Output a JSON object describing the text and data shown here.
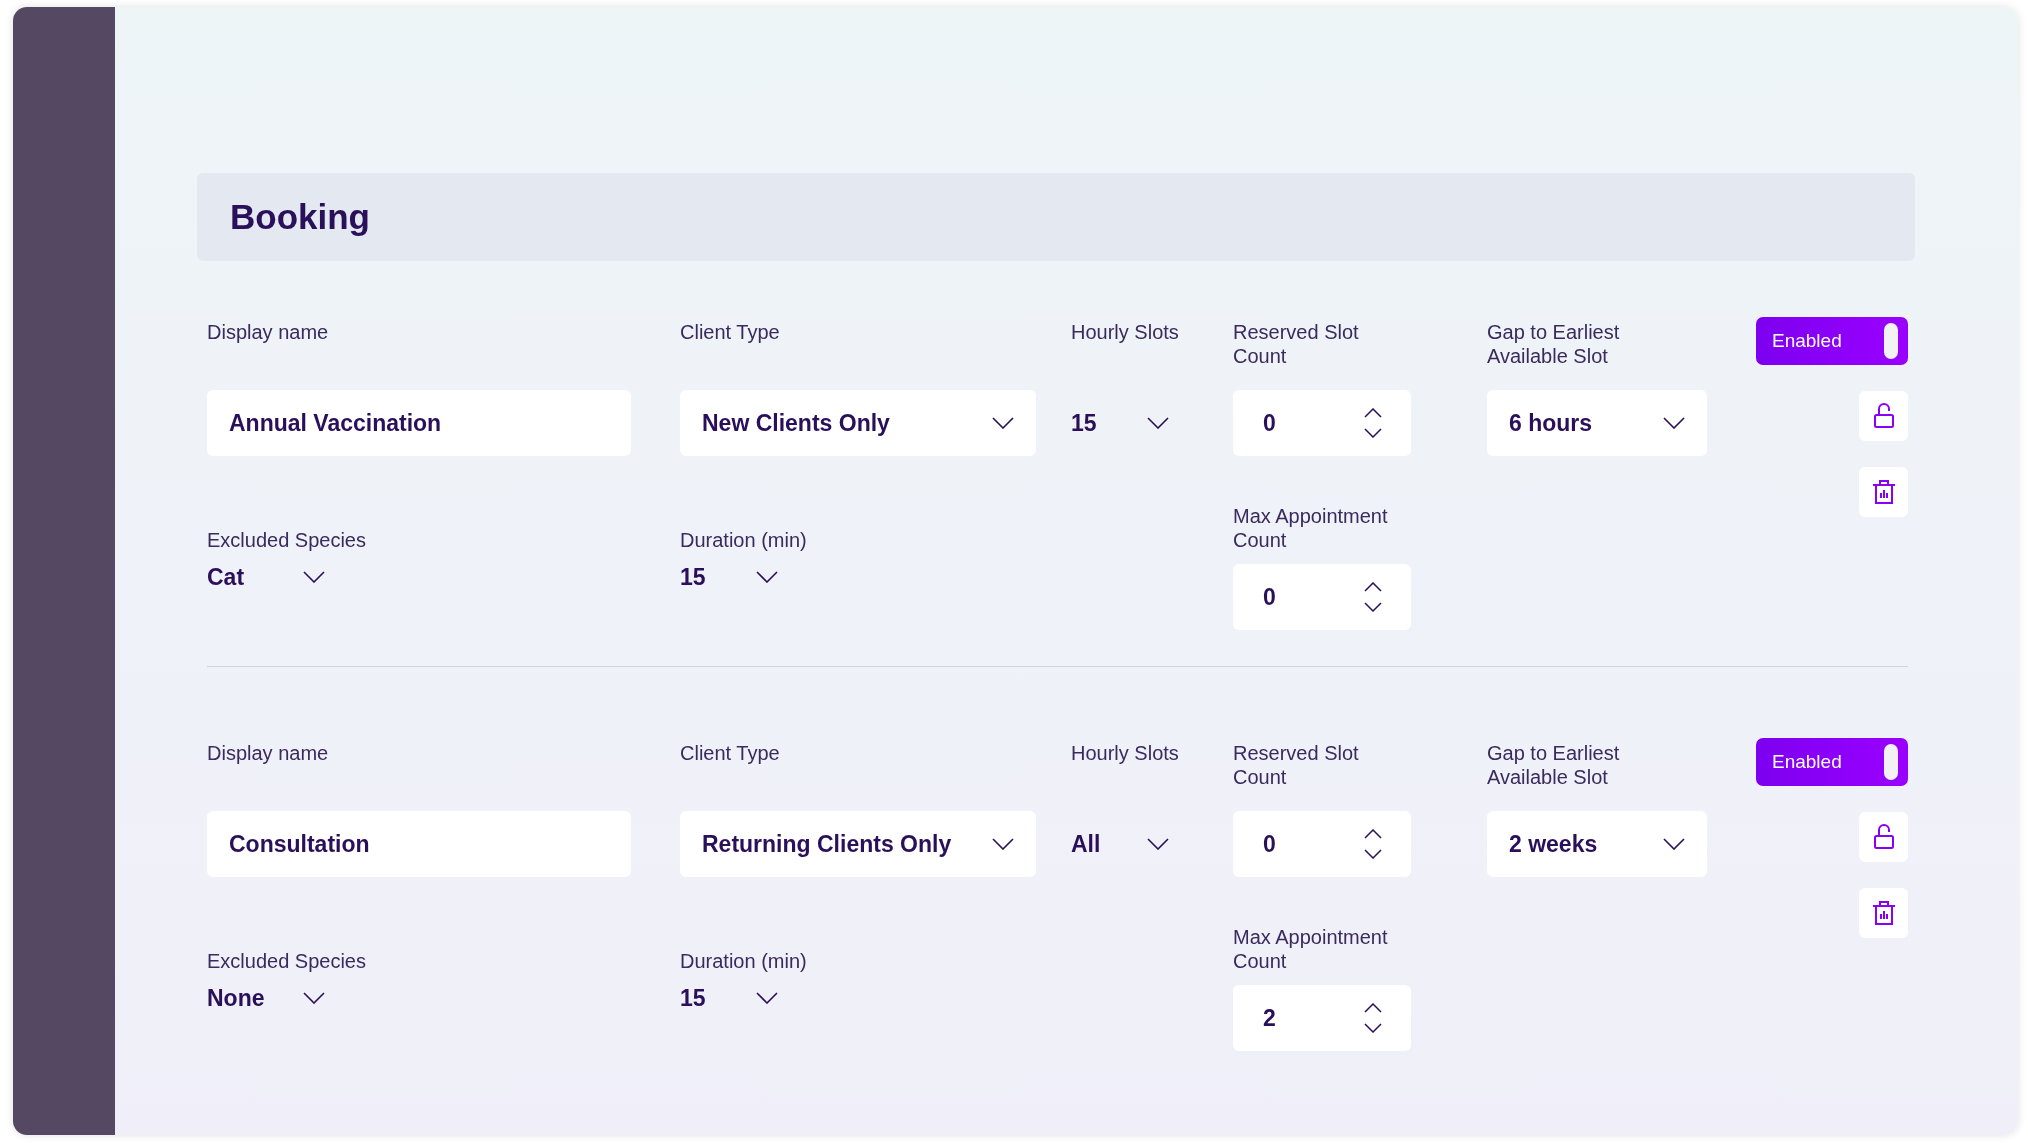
{
  "section": {
    "title": "Booking"
  },
  "bookings": [
    {
      "enabled": true,
      "toggle_label": "Enabled",
      "display_name": {
        "label": "Display name",
        "value": "Annual Vaccination"
      },
      "client_type": {
        "label": "Client Type",
        "value": "New Clients Only"
      },
      "hourly_slots": {
        "label": "Hourly Slots",
        "value": "15"
      },
      "reserved_slot_count": {
        "label": "Reserved Slot Count",
        "value": "0"
      },
      "gap_to_earliest": {
        "label": "Gap to Earliest Available Slot",
        "value": "6 hours"
      },
      "excluded_species": {
        "label": "Excluded Species",
        "value": "Cat"
      },
      "duration": {
        "label": "Duration (min)",
        "value": "15"
      },
      "max_appointment_count": {
        "label": "Max Appointment Count",
        "value": "0"
      }
    },
    {
      "enabled": true,
      "toggle_label": "Enabled",
      "display_name": {
        "label": "Display name",
        "value": "Consultation"
      },
      "client_type": {
        "label": "Client Type",
        "value": "Returning Clients Only"
      },
      "hourly_slots": {
        "label": "Hourly Slots",
        "value": "All"
      },
      "reserved_slot_count": {
        "label": "Reserved Slot Count",
        "value": "0"
      },
      "gap_to_earliest": {
        "label": "Gap to Earliest Available Slot",
        "value": "2 weeks"
      },
      "excluded_species": {
        "label": "Excluded Species",
        "value": "None"
      },
      "duration": {
        "label": "Duration (min)",
        "value": "15"
      },
      "max_appointment_count": {
        "label": "Max Appointment Count",
        "value": "2"
      }
    }
  ]
}
